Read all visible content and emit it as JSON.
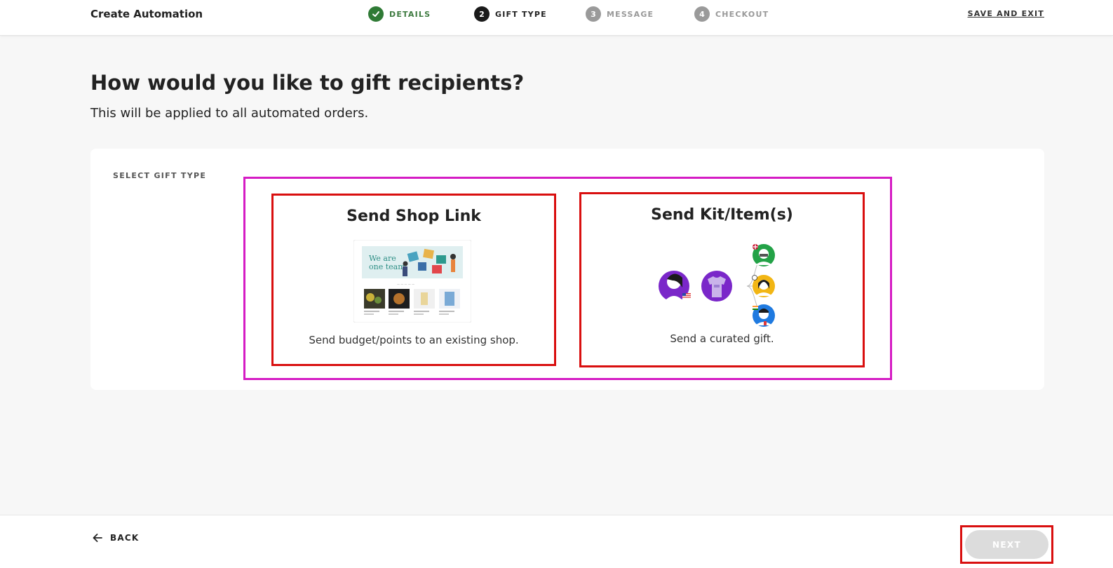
{
  "header": {
    "title": "Create Automation",
    "save_exit": "SAVE AND EXIT",
    "steps": [
      {
        "num": "✓",
        "label": "DETAILS",
        "state": "done"
      },
      {
        "num": "2",
        "label": "GIFT TYPE",
        "state": "current"
      },
      {
        "num": "3",
        "label": "MESSAGE",
        "state": "todo"
      },
      {
        "num": "4",
        "label": "CHECKOUT",
        "state": "todo"
      }
    ]
  },
  "main": {
    "title": "How would you like to gift recipients?",
    "subtitle": "This will be applied to all automated orders.",
    "section_label": "SELECT GIFT TYPE",
    "options": [
      {
        "title": "Send Shop Link",
        "description": "Send budget/points to an existing shop.",
        "image_text": "We are one team"
      },
      {
        "title": "Send Kit/Item(s)",
        "description": "Send a curated gift."
      }
    ]
  },
  "footer": {
    "back_label": "BACK",
    "next_label": "NEXT"
  },
  "colors": {
    "done": "#2f7a35",
    "current": "#1a1a1a",
    "todo": "#9a9a9a",
    "highlight_magenta": "#d51cc4",
    "highlight_red": "#d90f0f"
  }
}
